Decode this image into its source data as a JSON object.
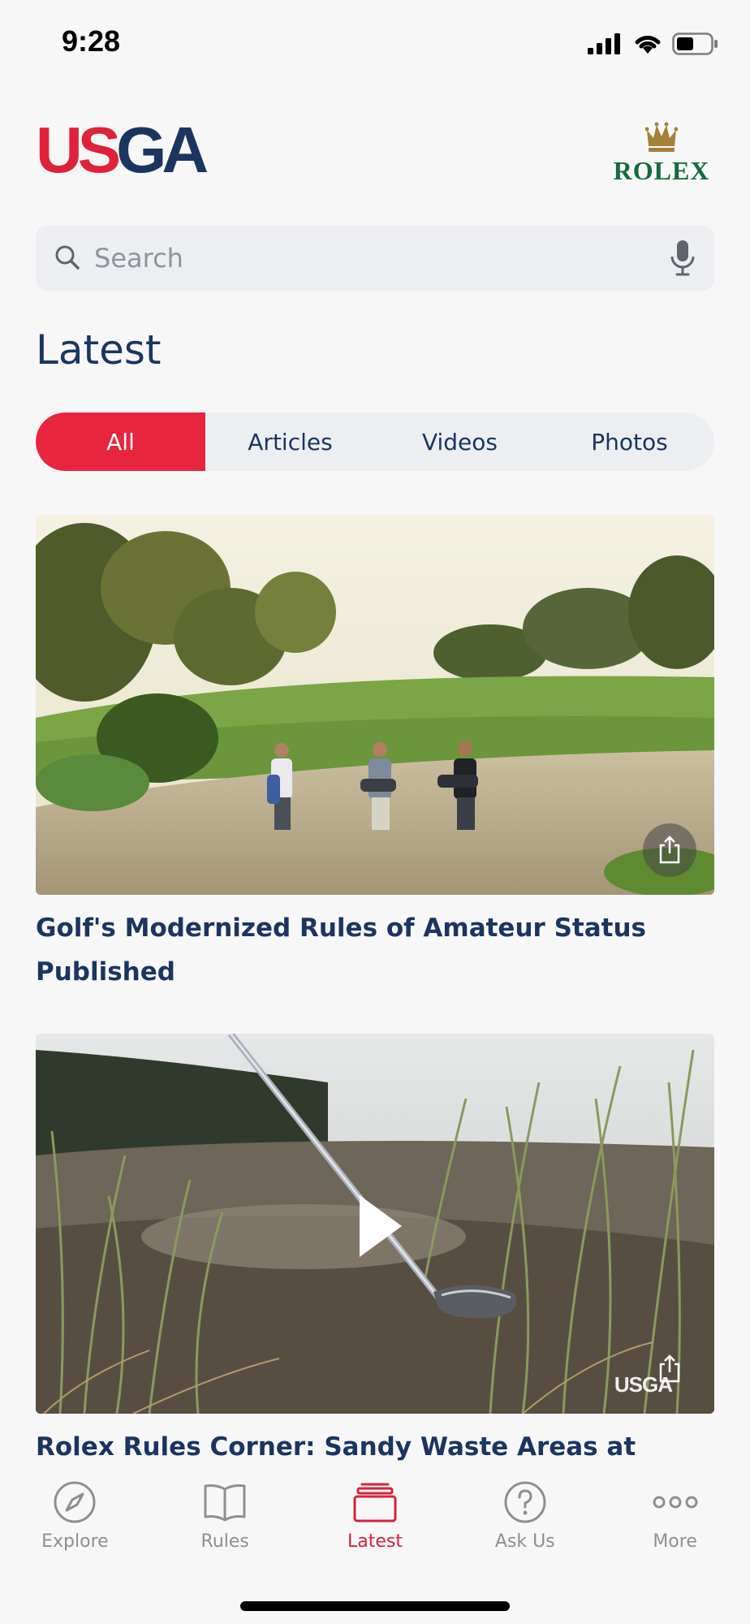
{
  "status_bar": {
    "time": "9:28"
  },
  "header": {
    "logo_us": "US",
    "logo_ga": "GA",
    "sponsor": "ROLEX"
  },
  "search": {
    "placeholder": "Search"
  },
  "section": {
    "title": "Latest"
  },
  "filter_tabs": [
    {
      "label": "All",
      "active": true
    },
    {
      "label": "Articles",
      "active": false
    },
    {
      "label": "Videos",
      "active": false
    },
    {
      "label": "Photos",
      "active": false
    }
  ],
  "cards": [
    {
      "title": "Golf's Modernized Rules of Amateur Status Published",
      "type": "article"
    },
    {
      "title": "Rolex Rules Corner: Sandy Waste Areas at Bandon",
      "type": "video",
      "watermark": "USGA"
    }
  ],
  "bottom_nav": [
    {
      "label": "Explore",
      "icon": "compass-icon",
      "active": false
    },
    {
      "label": "Rules",
      "icon": "book-icon",
      "active": false
    },
    {
      "label": "Latest",
      "icon": "stack-icon",
      "active": true
    },
    {
      "label": "Ask Us",
      "icon": "question-icon",
      "active": false
    },
    {
      "label": "More",
      "icon": "more-icon",
      "active": false
    }
  ],
  "colors": {
    "accent": "#e8253f",
    "navy": "#1b3561",
    "rolex_green": "#126b3c",
    "inactive": "#8c8f94"
  }
}
